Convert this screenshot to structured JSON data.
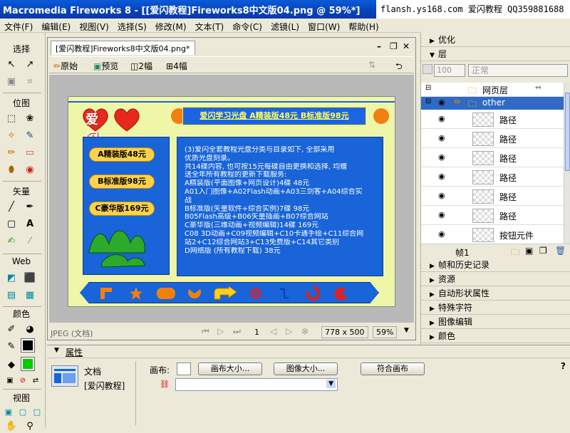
{
  "window": {
    "title": "Macromedia Fireworks 8 - [[爱闪教程]Fireworks8中文版04.png @ 59%*]",
    "watermark": "flansh.ys168.com 爱闪教程 QQ359881688"
  },
  "menu": [
    "文件(F)",
    "编辑(E)",
    "视图(V)",
    "选择(S)",
    "修改(M)",
    "文本(T)",
    "命令(C)",
    "滤镜(L)",
    "窗口(W)",
    "帮助(H)"
  ],
  "tools": {
    "sections": [
      "选择",
      "位图",
      "矢量",
      "Web",
      "颜色",
      "视图"
    ]
  },
  "document": {
    "tab": "[爱闪教程]Fireworks8中文版04.png*",
    "views": [
      "原始",
      "预览",
      "2幅",
      "4幅"
    ],
    "status": {
      "format": "JPEG (文档)",
      "frame": "1",
      "size": "778 x 500",
      "zoom": "59%"
    }
  },
  "artwork": {
    "logo": "爱闪",
    "banner": "爱闪学习光盘 A精装版48元 B标准版98元",
    "pills": [
      "A精装版48元",
      "B标准版98元",
      "C豪华版169元"
    ],
    "info_lines": [
      "(3)爱闪全套教程光盘分类与目录如下, 全部采用",
      "优质光盘刻录。",
      "共14碟内容, 也可按15元每碟自由更换和选择, 均赠",
      "送全年所有教程的更新下载服务:",
      "A精装版(平面图像+网页设计)4碟 48元",
      "A01入门图像+A02Flash动画+A03三剑客+A04综合实",
      "战",
      "B标准版(矢量软件+综合实例)7碟 98元",
      "B05Flash高级+B06矢量插画+B07综合网站",
      "C豪华版(三维动画+视频编辑)14碟 169元",
      "C08 3D动画+C09视频编辑+C10卡通手绘+C11综合网",
      "站2+C12综合网站3+C13免费版+C14其它类别",
      "D网络版 (所有教程下载) 38元"
    ]
  },
  "panels": {
    "optimize": "优化",
    "layers": {
      "title": "层",
      "opacity": "100",
      "blend": "正常",
      "web_layer": "网页层",
      "folder": "other",
      "items": [
        "路径",
        "路径",
        "路径",
        "路径",
        "路径",
        "路径",
        "按钮元件"
      ],
      "frame_label": "帧1"
    },
    "collapsed": [
      "帧和历史记录",
      "资源",
      "自动形状属性",
      "特殊字符",
      "图像编辑",
      "颜色"
    ]
  },
  "properties": {
    "title": "属性",
    "doc_label": "文档",
    "doc_name": "[爱闪教程]",
    "canvas_label": "画布:",
    "btn_canvas_size": "画布大小...",
    "btn_image_size": "图像大小...",
    "btn_fit_canvas": "符合画布",
    "help": "?"
  },
  "colors": {
    "titlebar": "#0842b8",
    "art_bg": "#f0f6a8",
    "art_blue": "#1864d8",
    "selected_layer": "#316ac5"
  }
}
